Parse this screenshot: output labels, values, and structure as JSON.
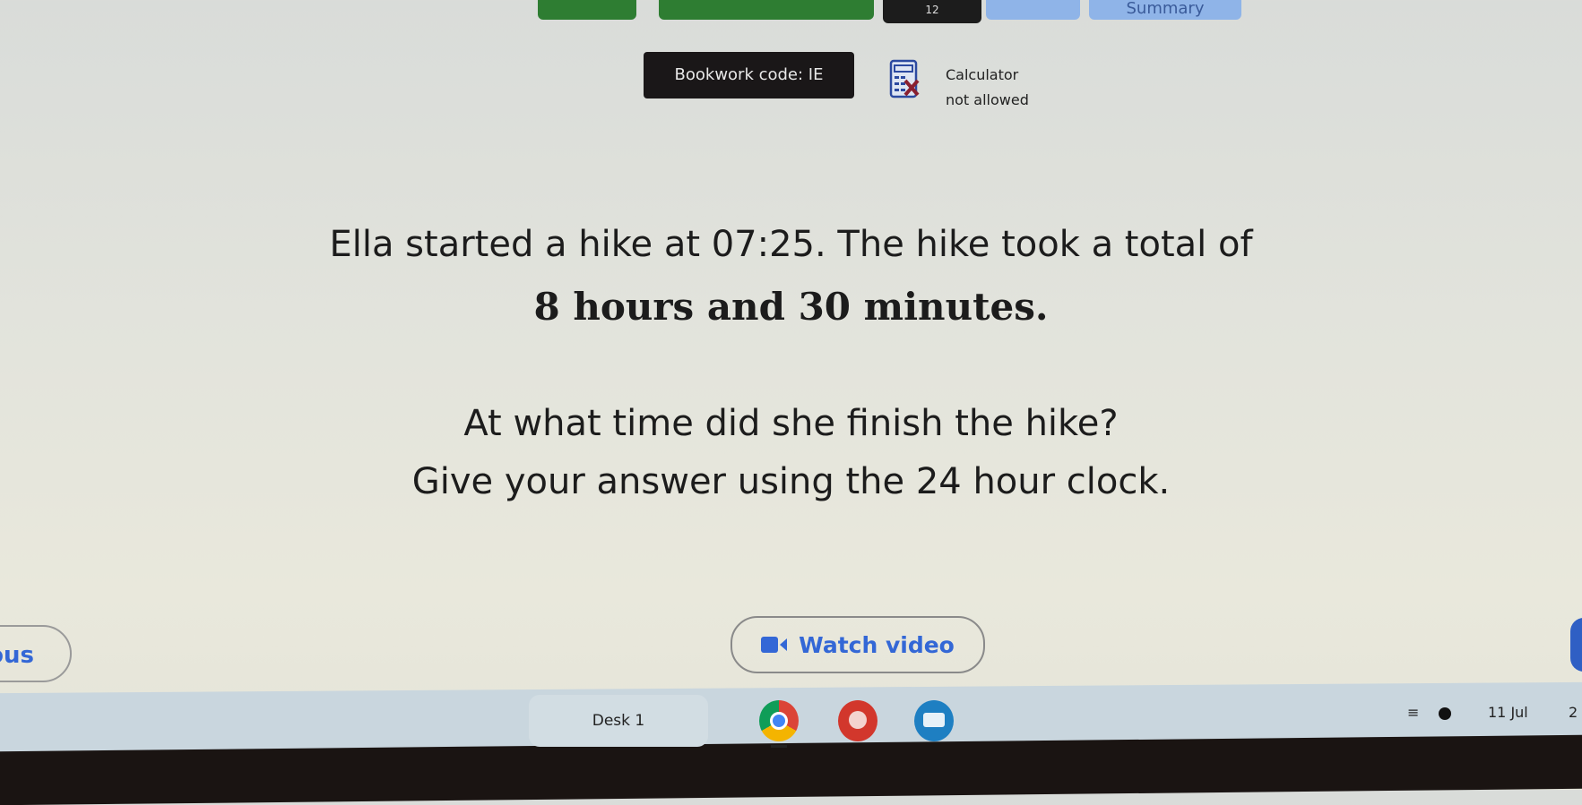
{
  "top_nav": {
    "black_button_label": "12",
    "summary_label": "Summary"
  },
  "bookwork": {
    "label": "Bookwork code: IE"
  },
  "calculator": {
    "line1": "Calculator",
    "line2": "not allowed",
    "icon": "calculator-not-allowed-icon"
  },
  "question": {
    "line1": "Ella started a hike at 07:25. The hike took a total of",
    "line2": "8 hours and 30 minutes.",
    "line3": "At what time did she finish the hike?",
    "line4": "Give your answer using the 24 hour clock."
  },
  "buttons": {
    "previous_label": "ous",
    "watch_video_label": "Watch video"
  },
  "colors": {
    "accent": "#3367d6",
    "bookwork_bg": "#1a1718",
    "nav_green": "#2e7d32"
  },
  "taskbar": {
    "desk_label": "Desk 1",
    "apps": [
      "chrome",
      "paint",
      "cast"
    ],
    "date": "11 Jul",
    "time_partial": "2"
  }
}
